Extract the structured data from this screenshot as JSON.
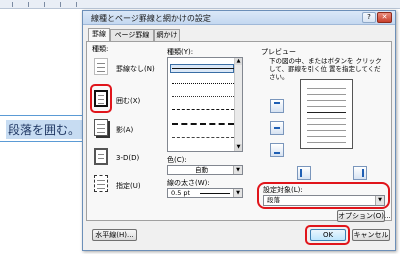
{
  "document": {
    "paragraph_text": "段落を囲む。"
  },
  "dialog": {
    "title": "線種とページ罫線と網かけの設定",
    "help_label": "?",
    "close_label": "✕",
    "tabs": [
      "罫線",
      "ページ罫線",
      "網かけ"
    ],
    "setting": {
      "heading": "種類:",
      "items": [
        {
          "label": "罫線なし(N)",
          "icon": "no-border-icon"
        },
        {
          "label": "囲む(X)",
          "icon": "box-border-icon"
        },
        {
          "label": "影(A)",
          "icon": "shadow-border-icon"
        },
        {
          "label": "3-D(D)",
          "icon": "3d-border-icon"
        },
        {
          "label": "指定(U)",
          "icon": "custom-border-icon"
        }
      ]
    },
    "style": {
      "heading": "種類(Y):",
      "color_label": "色(C):",
      "color_value": "自動",
      "width_label": "線の太さ(W):",
      "width_value": "0.5 pt"
    },
    "preview": {
      "heading": "プレビュー",
      "instruction": "下の図の中、またはボタンを クリックして、罫線を引く位 置を指定してください。",
      "apply_to_label": "設定対象(L):",
      "apply_to_value": "段落"
    },
    "buttons": {
      "options": "オプション(O)...",
      "horizontal_line": "水平線(H)...",
      "ok": "OK",
      "cancel": "キャンセル"
    }
  },
  "colors": {
    "highlight_ring": "#e0151b",
    "accent": "#1f5fb4"
  }
}
